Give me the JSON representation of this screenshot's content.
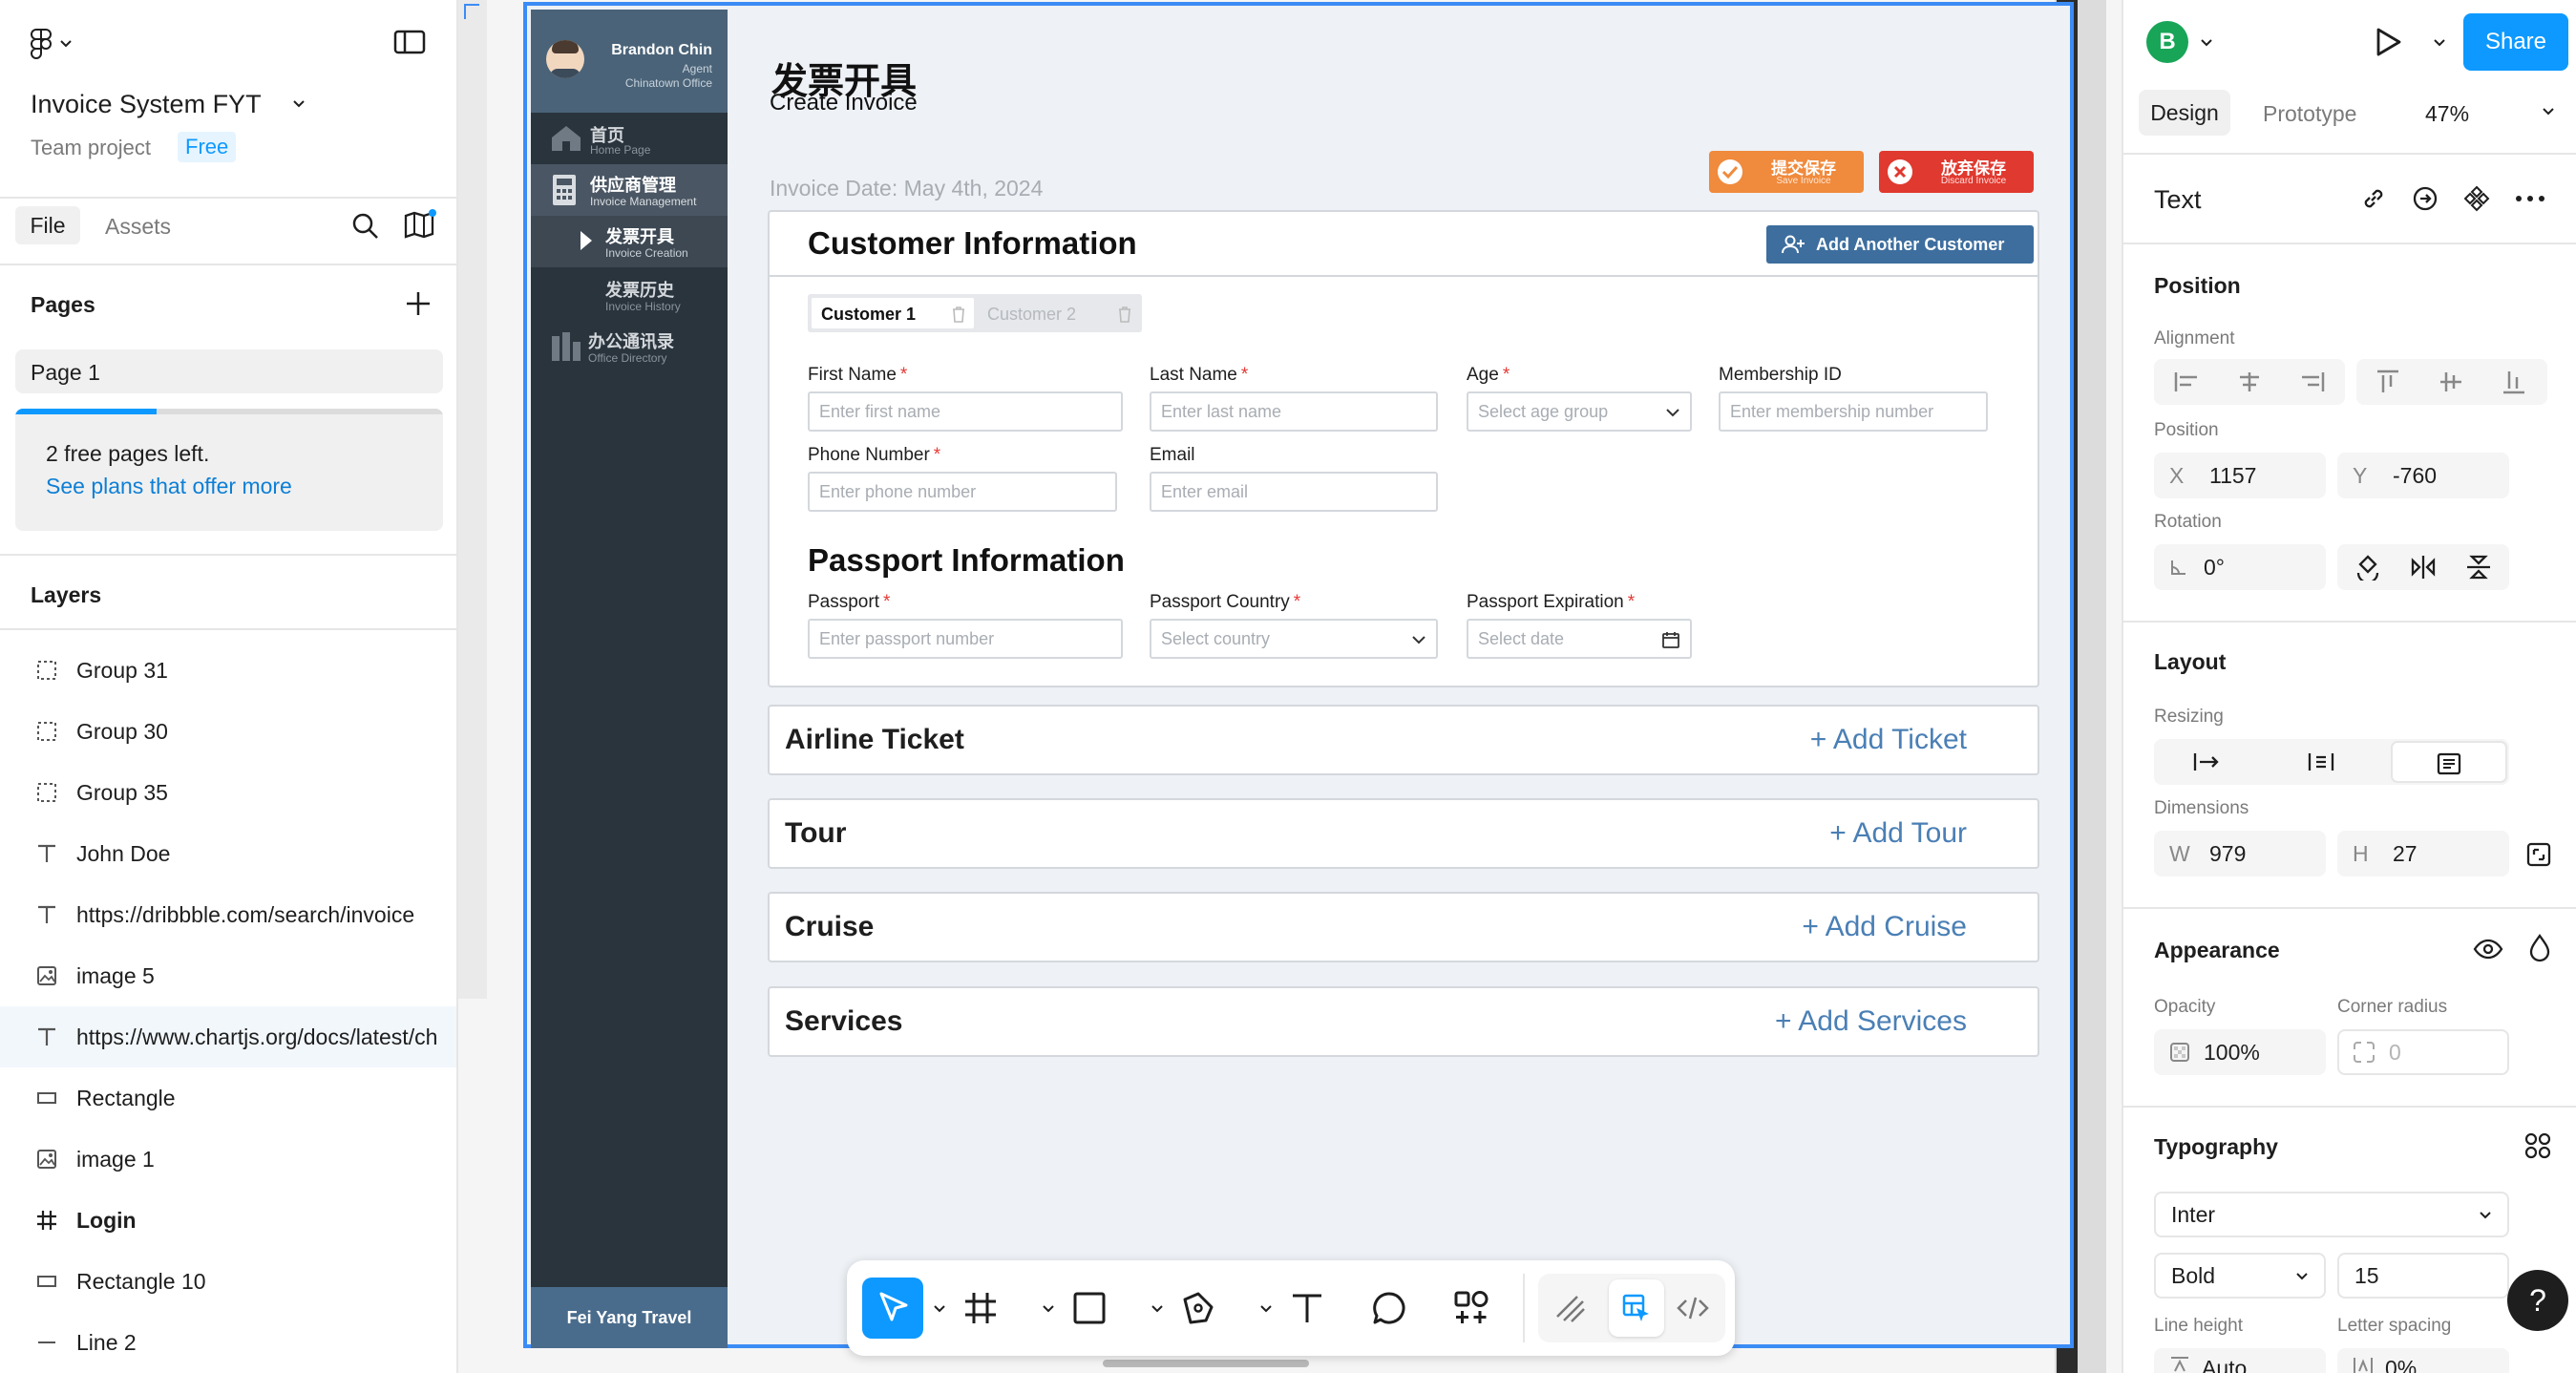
{
  "app": {
    "project_name": "Invoice System FYT",
    "team_label": "Team project",
    "plan_badge": "Free",
    "tabs": {
      "file": "File",
      "assets": "Assets"
    },
    "pages_heading": "Pages",
    "page_name": "Page 1",
    "free_pages_notice": "2 free pages left.",
    "plans_link": "See plans that offer more",
    "free_pages_progress": 0.33,
    "layers_heading": "Layers",
    "layers": [
      {
        "icon": "group-icon",
        "name": "Group 31"
      },
      {
        "icon": "group-icon",
        "name": "Group 30"
      },
      {
        "icon": "group-icon",
        "name": "Group 35"
      },
      {
        "icon": "text-icon",
        "name": "John Doe"
      },
      {
        "icon": "text-icon",
        "name": "https://dribbble.com/search/invoice"
      },
      {
        "icon": "image-icon",
        "name": "image 5"
      },
      {
        "icon": "text-icon",
        "name": "https://www.chartjs.org/docs/latest/ch"
      },
      {
        "icon": "rectangle-icon",
        "name": "Rectangle"
      },
      {
        "icon": "image-icon",
        "name": "image 1"
      },
      {
        "icon": "frame-icon",
        "name": "Login"
      },
      {
        "icon": "rectangle-icon",
        "name": "Rectangle 10"
      },
      {
        "icon": "line-icon",
        "name": "Line 2"
      }
    ]
  },
  "design": {
    "agent_name": "Brandon Chin",
    "agent_role": "Agent",
    "agent_office": "Chinatown Office",
    "nav": [
      {
        "cn": "首页",
        "en": "Home Page"
      },
      {
        "cn": "供应商管理",
        "en": "Invoice Management"
      },
      {
        "cn": "发票开具",
        "en": "Invoice Creation"
      },
      {
        "cn": "发票历史",
        "en": "Invoice History"
      },
      {
        "cn": "办公通讯录",
        "en": "Office Directory"
      }
    ],
    "company_footer": "Fei Yang Travel",
    "title_cn": "发票开具",
    "title_en": "Create Invoice",
    "invoice_date": "Invoice Date: May 4th, 2024",
    "save_button": {
      "cn": "提交保存",
      "en": "Save Invoice"
    },
    "discard_button": {
      "cn": "放弃保存",
      "en": "Discard Invoice"
    },
    "customer_heading": "Customer Information",
    "add_customer": "Add Another Customer",
    "customer_tabs": [
      "Customer 1",
      "Customer 2"
    ],
    "fields": {
      "first_name": {
        "label": "First Name",
        "placeholder": "Enter first name"
      },
      "last_name": {
        "label": "Last Name",
        "placeholder": "Enter last name"
      },
      "age": {
        "label": "Age",
        "placeholder": "Select age group"
      },
      "membership": {
        "label": "Membership ID",
        "placeholder": "Enter membership number"
      },
      "phone": {
        "label": "Phone Number",
        "placeholder": "Enter phone number"
      },
      "email": {
        "label": "Email",
        "placeholder": "Enter email"
      },
      "passport": {
        "label": "Passport",
        "placeholder": "Enter passport number"
      },
      "passport_country": {
        "label": "Passport Country",
        "placeholder": "Select country"
      },
      "passport_expiration": {
        "label": "Passport Expiration",
        "placeholder": "Select date"
      }
    },
    "required_mark": "*",
    "passport_heading": "Passport Information",
    "sections": [
      {
        "title": "Airline Ticket",
        "action": "+ Add Ticket"
      },
      {
        "title": "Tour",
        "action": "+ Add Tour"
      },
      {
        "title": "Cruise",
        "action": "+ Add Cruise"
      },
      {
        "title": "Services",
        "action": "+ Add Services"
      }
    ]
  },
  "right_panel": {
    "avatar_letter": "B",
    "share_label": "Share",
    "tabs": {
      "design": "Design",
      "prototype": "Prototype"
    },
    "zoom": "47%",
    "selection_type": "Text",
    "position_heading": "Position",
    "alignment_label": "Alignment",
    "position_label": "Position",
    "x_label": "X",
    "x_value": "1157",
    "y_label": "Y",
    "y_value": "-760",
    "rotation_label": "Rotation",
    "rotation_value": "0°",
    "layout_heading": "Layout",
    "resizing_label": "Resizing",
    "dimensions_label": "Dimensions",
    "w_label": "W",
    "w_value": "979",
    "h_label": "H",
    "h_value": "27",
    "appearance_heading": "Appearance",
    "opacity_label": "Opacity",
    "opacity_value": "100%",
    "corner_label": "Corner radius",
    "corner_value": "0",
    "typography_heading": "Typography",
    "font_family": "Inter",
    "font_weight": "Bold",
    "font_size": "15",
    "line_height_label": "Line height",
    "letter_spacing_label": "Letter spacing",
    "line_height_value": "Auto",
    "letter_spacing_value": "0%",
    "help_label": "?"
  },
  "colors": {
    "accent": "#0d99ff",
    "frame_border": "#3b8cf5",
    "sidebar_bg": "#2a343d",
    "save_orange": "#f08a3c",
    "discard_red": "#e0392f",
    "link_blue": "#4a7fb5",
    "add_customer_bg": "#3d6e9e"
  }
}
